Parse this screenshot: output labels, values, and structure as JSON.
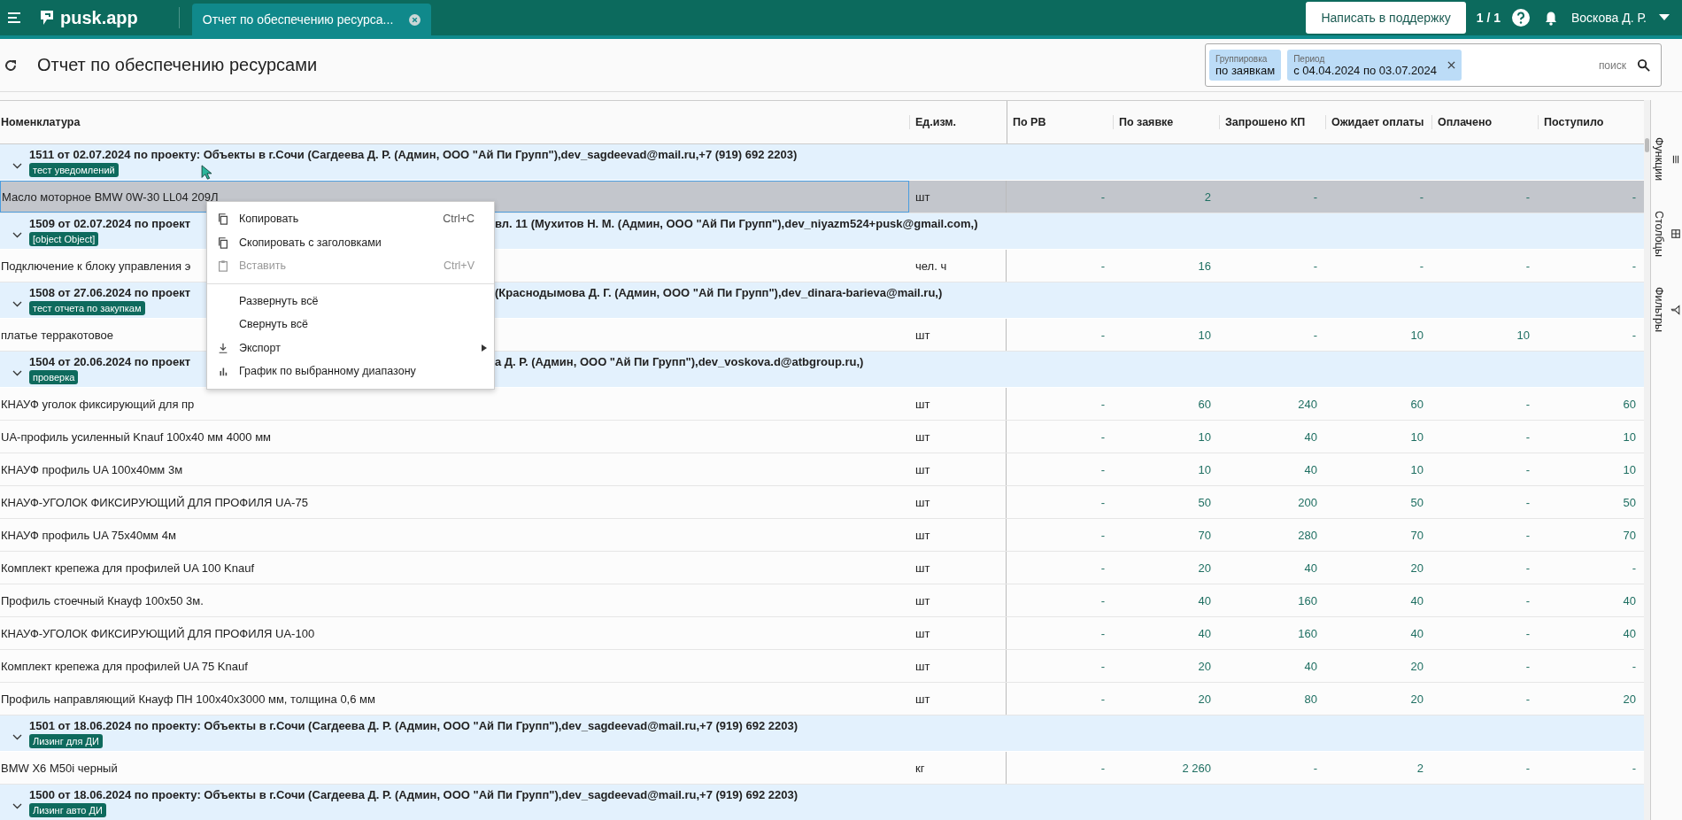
{
  "top_bar": {
    "logo": "pusk.app",
    "tab": {
      "label": "Отчет по обеспечению ресурса...",
      "selected": true
    },
    "support_button": "Написать в поддержку",
    "counter": "1 / 1",
    "user": "Воскова Д. Р."
  },
  "page": {
    "title": "Отчет по обеспечению ресурсами",
    "filters": [
      {
        "label": "Группировка",
        "value": "по заявкам",
        "removable": false
      },
      {
        "label": "Период",
        "value": "с 04.04.2024 по 03.07.2024",
        "removable": true
      }
    ],
    "search": {
      "placeholder": "поиск"
    }
  },
  "table": {
    "columns": [
      "Номенклатура",
      "Ед.изм.",
      "По РВ",
      "По заявке",
      "Запрошено КП",
      "Ожидает оплаты",
      "Оплачено",
      "Поступило"
    ],
    "groups": [
      {
        "title": "1511 от 02.07.2024 по проекту: Объекты в г.Сочи (Сагдеева Д. Р. (Админ, ООО \"Ай Пи Групп\"),dev_sagdeevad@mail.ru,+7 (919) 692 2203)",
        "tag": "тест уведомлений",
        "expanded": true,
        "rows": [
          {
            "name": "Масло моторное BMW 0W-30 LL04 209Л",
            "unit": "шт",
            "values": [
              "-",
              "2",
              "-",
              "-",
              "-",
              "-"
            ],
            "selected": true
          }
        ]
      },
      {
        "title": "1509 от 02.07.2024 по проект",
        "title_end": "вл. 11 (Мухитов Н. М. (Админ, ООО \"Ай Пи Групп\"),dev_niyazm524+pusk@gmail.com,)",
        "tag": "[object Object]",
        "expanded": true,
        "rows": [
          {
            "name": "Подключение к блоку управления э",
            "unit": "чел. ч",
            "values": [
              "-",
              "16",
              "-",
              "-",
              "-",
              "-"
            ],
            "selected": false
          }
        ]
      },
      {
        "title": "1508 от 27.06.2024 по проект",
        "title_end": "(Краснодымова Д. Г. (Админ, ООО \"Ай Пи Групп\"),dev_dinara-barieva@mail.ru,)",
        "tag": "тест отчета по закупкам",
        "expanded": true,
        "rows": [
          {
            "name": "платье терракотовое",
            "unit": "шт",
            "values": [
              "-",
              "10",
              "-",
              "10",
              "10",
              "-"
            ],
            "selected": false
          }
        ]
      },
      {
        "title": "1504 от 20.06.2024 по проект",
        "title_end": "а Д. Р. (Админ, ООО \"Ай Пи Групп\"),dev_voskova.d@atbgroup.ru,)",
        "tag": "проверка",
        "expanded": true,
        "rows": [
          {
            "name": "КНАУФ уголок фиксирующий для пр",
            "unit": "шт",
            "values": [
              "-",
              "60",
              "240",
              "60",
              "-",
              "60"
            ],
            "selected": false
          },
          {
            "name": "UA-профиль усиленный Knauf 100x40 мм 4000 мм",
            "unit": "шт",
            "values": [
              "-",
              "10",
              "40",
              "10",
              "-",
              "10"
            ],
            "selected": false
          },
          {
            "name": "КНАУФ профиль UA 100x40мм 3м",
            "unit": "шт",
            "values": [
              "-",
              "10",
              "40",
              "10",
              "-",
              "10"
            ],
            "selected": false
          },
          {
            "name": "КНАУФ-УГОЛОК ФИКСИРУЮЩИЙ ДЛЯ ПРОФИЛЯ UA-75",
            "unit": "шт",
            "values": [
              "-",
              "50",
              "200",
              "50",
              "-",
              "50"
            ],
            "selected": false
          },
          {
            "name": "КНАУФ профиль UA 75x40мм 4м",
            "unit": "шт",
            "values": [
              "-",
              "70",
              "280",
              "70",
              "-",
              "70"
            ],
            "selected": false
          },
          {
            "name": "Комплект крепежа для профилей UA 100 Knauf",
            "unit": "шт",
            "values": [
              "-",
              "20",
              "40",
              "20",
              "-",
              "-"
            ],
            "selected": false
          },
          {
            "name": "Профиль стоечный Кнауф 100x50 3м.",
            "unit": "шт",
            "values": [
              "-",
              "40",
              "160",
              "40",
              "-",
              "40"
            ],
            "selected": false
          },
          {
            "name": "КНАУФ-УГОЛОК ФИКСИРУЮЩИЙ ДЛЯ ПРОФИЛЯ UA-100",
            "unit": "шт",
            "values": [
              "-",
              "40",
              "160",
              "40",
              "-",
              "40"
            ],
            "selected": false
          },
          {
            "name": "Комплект крепежа для профилей UA 75 Knauf",
            "unit": "шт",
            "values": [
              "-",
              "20",
              "40",
              "20",
              "-",
              "-"
            ],
            "selected": false
          },
          {
            "name": "Профиль направляющий Кнауф ПН 100x40x3000 мм, толщина 0,6 мм",
            "unit": "шт",
            "values": [
              "-",
              "20",
              "80",
              "20",
              "-",
              "20"
            ],
            "selected": false
          }
        ]
      },
      {
        "title": "1501 от 18.06.2024 по проекту: Объекты в г.Сочи (Сагдеева Д. Р. (Админ, ООО \"Ай Пи Групп\"),dev_sagdeevad@mail.ru,+7 (919) 692 2203)",
        "tag": "Лизинг для ДИ",
        "expanded": true,
        "rows": [
          {
            "name": "BMW X6 M50i черный",
            "unit": "кг",
            "values": [
              "-",
              "2 260",
              "-",
              "2",
              "-",
              "-"
            ],
            "selected": false
          }
        ]
      },
      {
        "title": "1500 от 18.06.2024 по проекту: Объекты в г.Сочи (Сагдеева Д. Р. (Админ, ООО \"Ай Пи Групп\"),dev_sagdeevad@mail.ru,+7 (919) 692 2203)",
        "tag": "Лизинг авто ДИ",
        "expanded": true
      }
    ]
  },
  "side_panel": [
    {
      "kind": "functions",
      "label": "Функции"
    },
    {
      "kind": "columns",
      "label": "Столбцы"
    },
    {
      "kind": "filters",
      "label": "Фильтры"
    }
  ],
  "context_menu": {
    "sections": [
      [
        {
          "kind": "copy",
          "label": "Копировать",
          "shortcut": "Ctrl+C",
          "disabled": false
        },
        {
          "kind": "copy",
          "label": "Скопировать с заголовками",
          "disabled": false
        },
        {
          "kind": "paste",
          "label": "Вставить",
          "shortcut": "Ctrl+V",
          "disabled": true
        }
      ],
      [
        {
          "kind": "plain",
          "label": "Развернуть всё",
          "disabled": false
        },
        {
          "kind": "plain",
          "label": "Свернуть всё",
          "disabled": false
        },
        {
          "kind": "export",
          "label": "Экспорт",
          "disabled": false,
          "submenu": true
        },
        {
          "kind": "chart",
          "label": "График по выбранному диапазону",
          "disabled": false
        }
      ]
    ]
  }
}
